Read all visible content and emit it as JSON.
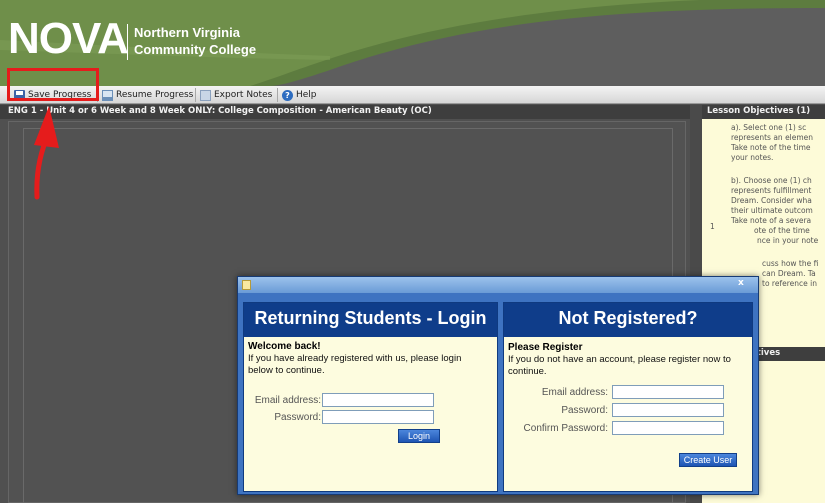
{
  "header": {
    "logo_word": "NOVA",
    "logo_name_line1": "Northern Virginia",
    "logo_name_line2": "Community College"
  },
  "toolbar": {
    "save_label": "Save Progress",
    "resume_label": "Resume Progress",
    "export_label": "Export Notes",
    "help_label": "Help"
  },
  "lesson": {
    "title": "ENG 1    - Unit 4    or 6 Week and 8 Week ONLY: College Composition - American Beauty (OC)"
  },
  "objectives": {
    "title": "Lesson Objectives (1)",
    "number": "1",
    "lines": [
      "a). Select one (1) sc",
      "represents an elemen",
      "Take note of the time",
      "your notes.",
      "b). Choose one (1) ch",
      "represents fulfillment",
      "Dream. Consider wha",
      "their ultimate outcom",
      "Take note of a severa",
      "ote of the time",
      "nce in your note",
      "cuss how the fi",
      "can Dream. Ta",
      "to reference in"
    ],
    "second_title": "bjectives"
  },
  "dialog": {
    "close_label": "x",
    "login": {
      "title": "Returning Students - Login",
      "welcome": "Welcome back!",
      "line1": "If you have already registered with us, please login",
      "line2": "below to continue.",
      "email_label": "Email address:",
      "password_label": "Password:",
      "button_label": "Login"
    },
    "register": {
      "title": "Not Registered?",
      "heading": "Please Register",
      "line1": "If you do not have an account, please register now to",
      "line2": "continue.",
      "email_label": "Email address:",
      "password_label": "Password:",
      "confirm_label": "Confirm Password:",
      "button_label": "Create User"
    }
  },
  "colors": {
    "header_swoosh": "#6f8f4a",
    "annotation_red": "#e51c1c",
    "dialog_blue": "#0f3d8a",
    "pane_background": "#fdfcdf"
  }
}
